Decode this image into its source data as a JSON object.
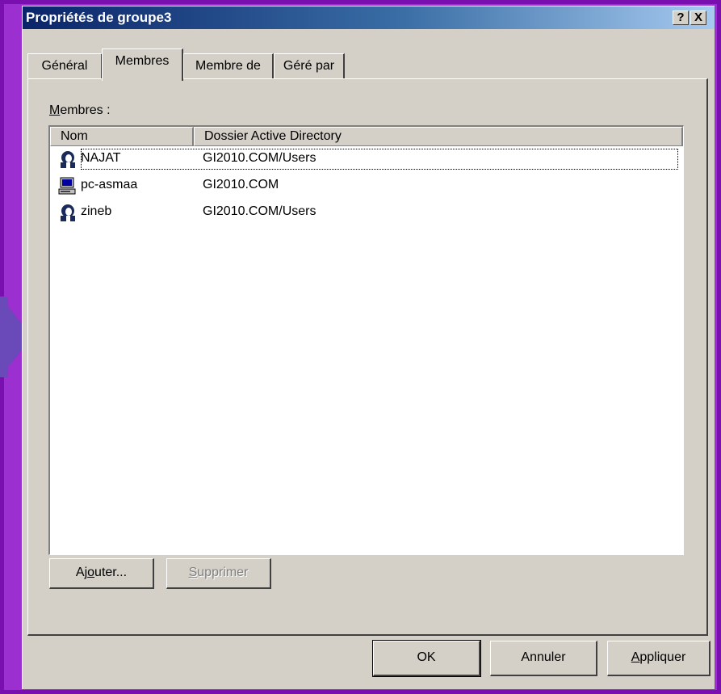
{
  "window": {
    "title": "Propriétés de groupe3",
    "help_label": "?",
    "close_label": "X"
  },
  "tabs": [
    {
      "label": "Général",
      "active": false
    },
    {
      "label": "Membres",
      "active": true
    },
    {
      "label": "Membre de",
      "active": false
    },
    {
      "label": "Géré par",
      "active": false
    }
  ],
  "members": {
    "label_first": "M",
    "label_rest": "embres :",
    "columns": [
      "Nom",
      "Dossier Active Directory"
    ],
    "rows": [
      {
        "name": "NAJAT",
        "folder": "GI2010.COM/Users",
        "icon": "user-icon"
      },
      {
        "name": "pc-asmaa",
        "folder": "GI2010.COM",
        "icon": "computer-icon"
      },
      {
        "name": "zineb",
        "folder": "GI2010.COM/Users",
        "icon": "user-icon"
      }
    ]
  },
  "buttons": {
    "add_pre": "Aj",
    "add_key": "o",
    "add_post": "uter...",
    "remove_key": "S",
    "remove_rest": "upprimer",
    "ok": "OK",
    "cancel": "Annuler",
    "apply_key": "A",
    "apply_rest": "ppliquer"
  },
  "colors": {
    "background_frame": "#7a0fb0",
    "titlebar_start": "#0a246a",
    "dialog_face": "#d4d0c8"
  }
}
